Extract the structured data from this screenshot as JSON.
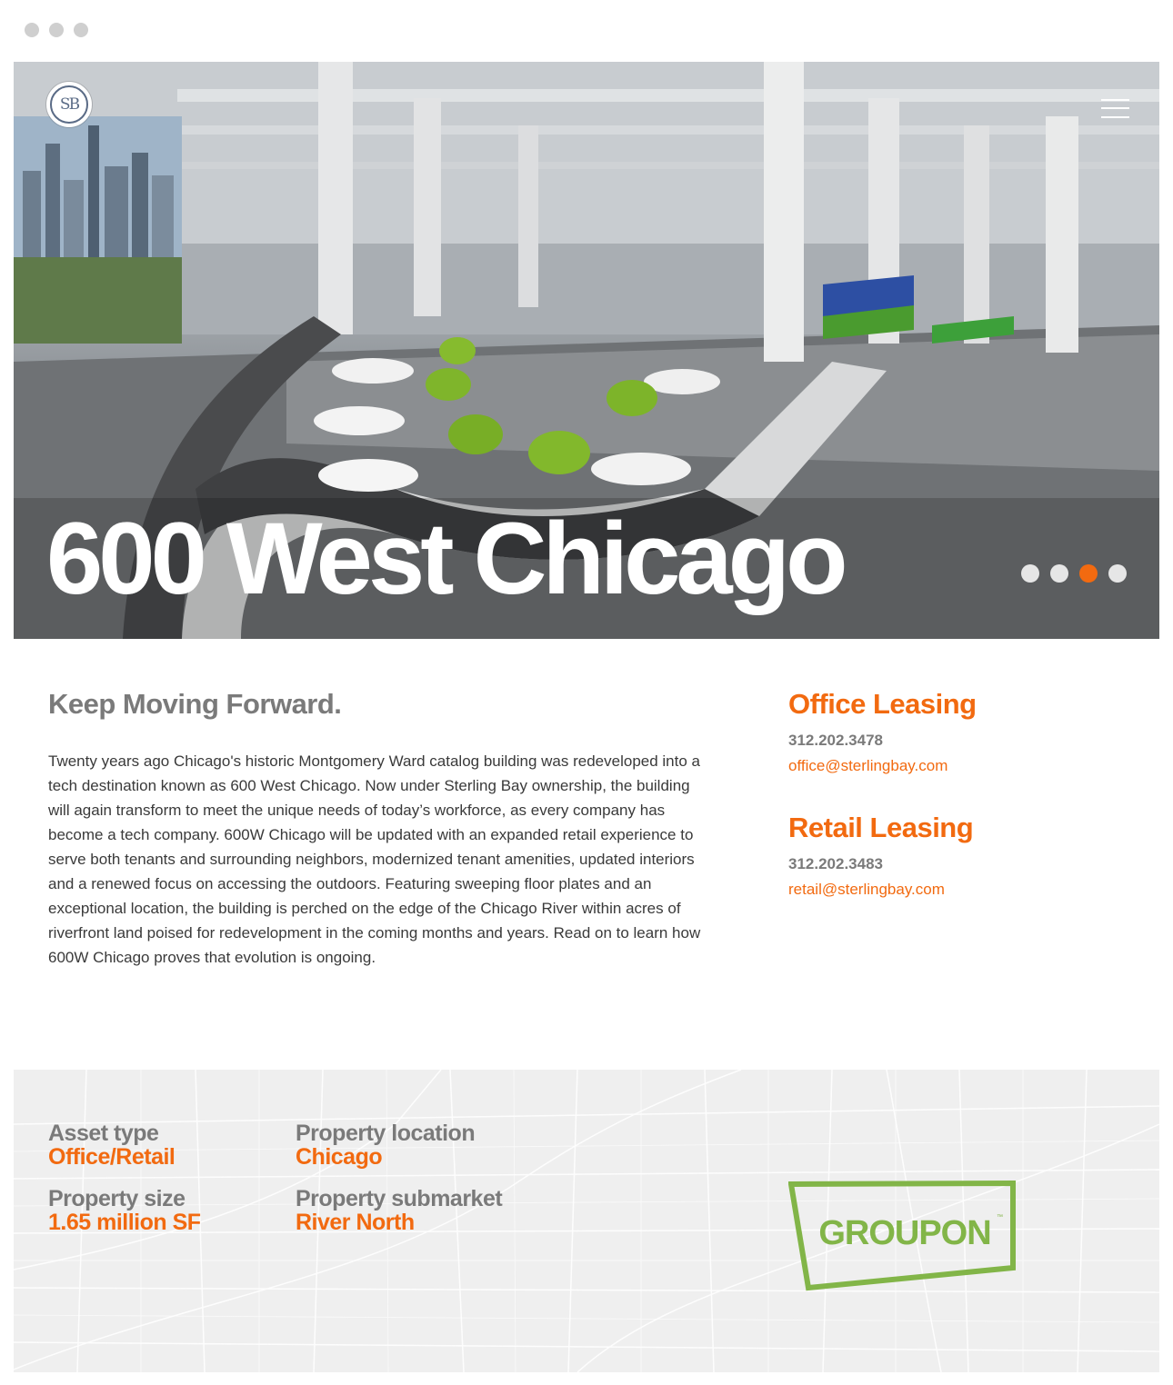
{
  "window": {
    "controls": [
      "close",
      "minimize",
      "maximize"
    ]
  },
  "hero": {
    "title": "600 West Chicago",
    "logo_text": "SB",
    "slides": 4,
    "active_slide": 3,
    "menu_icon": "hamburger-menu-icon"
  },
  "intro": {
    "heading": "Keep Moving Forward.",
    "body": "Twenty years ago Chicago's historic Montgomery Ward catalog building was redeveloped into a tech destination known as 600 West Chicago. Now under Sterling Bay ownership, the building will again transform to meet the unique needs of today’s workforce, as every company has become a tech company. 600W Chicago will be updated with an expanded retail experience to serve both tenants and surrounding neighbors, modernized tenant amenities, updated interiors and a renewed focus on accessing the outdoors. Featuring sweeping floor plates and an exceptional location, the building is perched on the edge of the Chicago River within acres of riverfront land poised for redevelopment in the coming months and years. Read on to learn how 600W Chicago proves that evolution is ongoing."
  },
  "contacts": {
    "office": {
      "heading": "Office Leasing",
      "phone": "312.202.3478",
      "email": "office@sterlingbay.com"
    },
    "retail": {
      "heading": "Retail Leasing",
      "phone": "312.202.3483",
      "email": "retail@sterlingbay.com"
    }
  },
  "details": {
    "asset_type": {
      "label": "Asset type",
      "value": "Office/Retail"
    },
    "location": {
      "label": "Property location",
      "value": "Chicago"
    },
    "size": {
      "label": "Property size",
      "value": "1.65 million SF"
    },
    "submarket": {
      "label": "Property submarket",
      "value": "River North"
    },
    "tenant_logo": "GROUPON"
  },
  "colors": {
    "accent": "#f26a10",
    "heading_gray": "#7a7a7a",
    "band_bg": "#efefef",
    "groupon_green": "#82b548"
  }
}
